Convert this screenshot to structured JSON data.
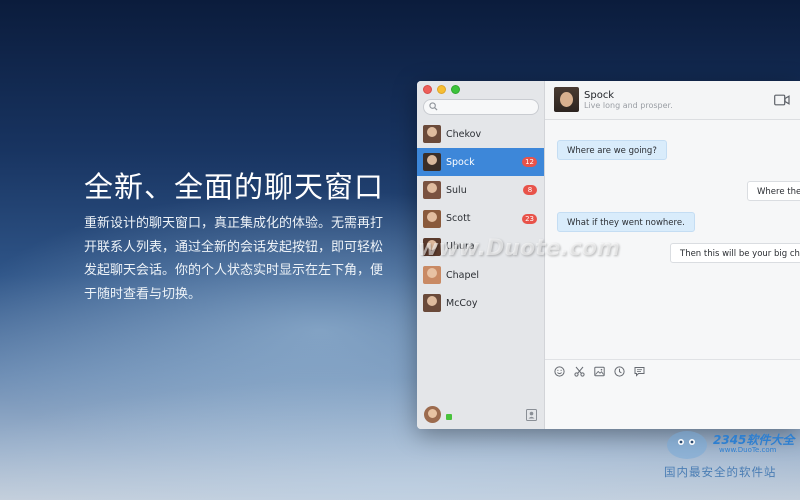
{
  "hero": {
    "title": "全新、全面的聊天窗口",
    "desc": "重新设计的聊天窗口，真正集成化的体验。无需再打开联系人列表，通过全新的会话发起按钮，即可轻松发起聊天会话。你的个人状态实时显示在左下角，便于随时查看与切换。"
  },
  "watermark": {
    "top": "www.Duote.com",
    "brand": "2345软件大全",
    "url": "www.DuoTe.com",
    "slogan": "国内最安全的软件站"
  },
  "sidebar": {
    "contacts": [
      {
        "name": "Chekov",
        "badge": "",
        "active": false,
        "color": "#6b4a3a"
      },
      {
        "name": "Spock",
        "badge": "12",
        "active": true,
        "color": "#3b2e28"
      },
      {
        "name": "Sulu",
        "badge": "8",
        "active": false,
        "color": "#7a5240"
      },
      {
        "name": "Scott",
        "badge": "23",
        "active": false,
        "color": "#8a5a3c"
      },
      {
        "name": "Uhura",
        "badge": "",
        "active": false,
        "color": "#5a3a2c"
      },
      {
        "name": "Chapel",
        "badge": "",
        "active": false,
        "color": "#c98a64"
      },
      {
        "name": "McCoy",
        "badge": "",
        "active": false,
        "color": "#6a4a3a"
      }
    ]
  },
  "chat": {
    "name": "Spock",
    "status": "Live long and prosper.",
    "messages": [
      {
        "dir": "in",
        "text": "Where are we going?"
      },
      {
        "dir": "out",
        "text": "Where they"
      },
      {
        "dir": "in",
        "text": "What if they went nowhere."
      },
      {
        "dir": "out",
        "text": "Then this will be your big chan"
      }
    ]
  },
  "colors": {
    "accent": "#3d87d9",
    "badge": "#e8534a",
    "online": "#48c23c"
  }
}
